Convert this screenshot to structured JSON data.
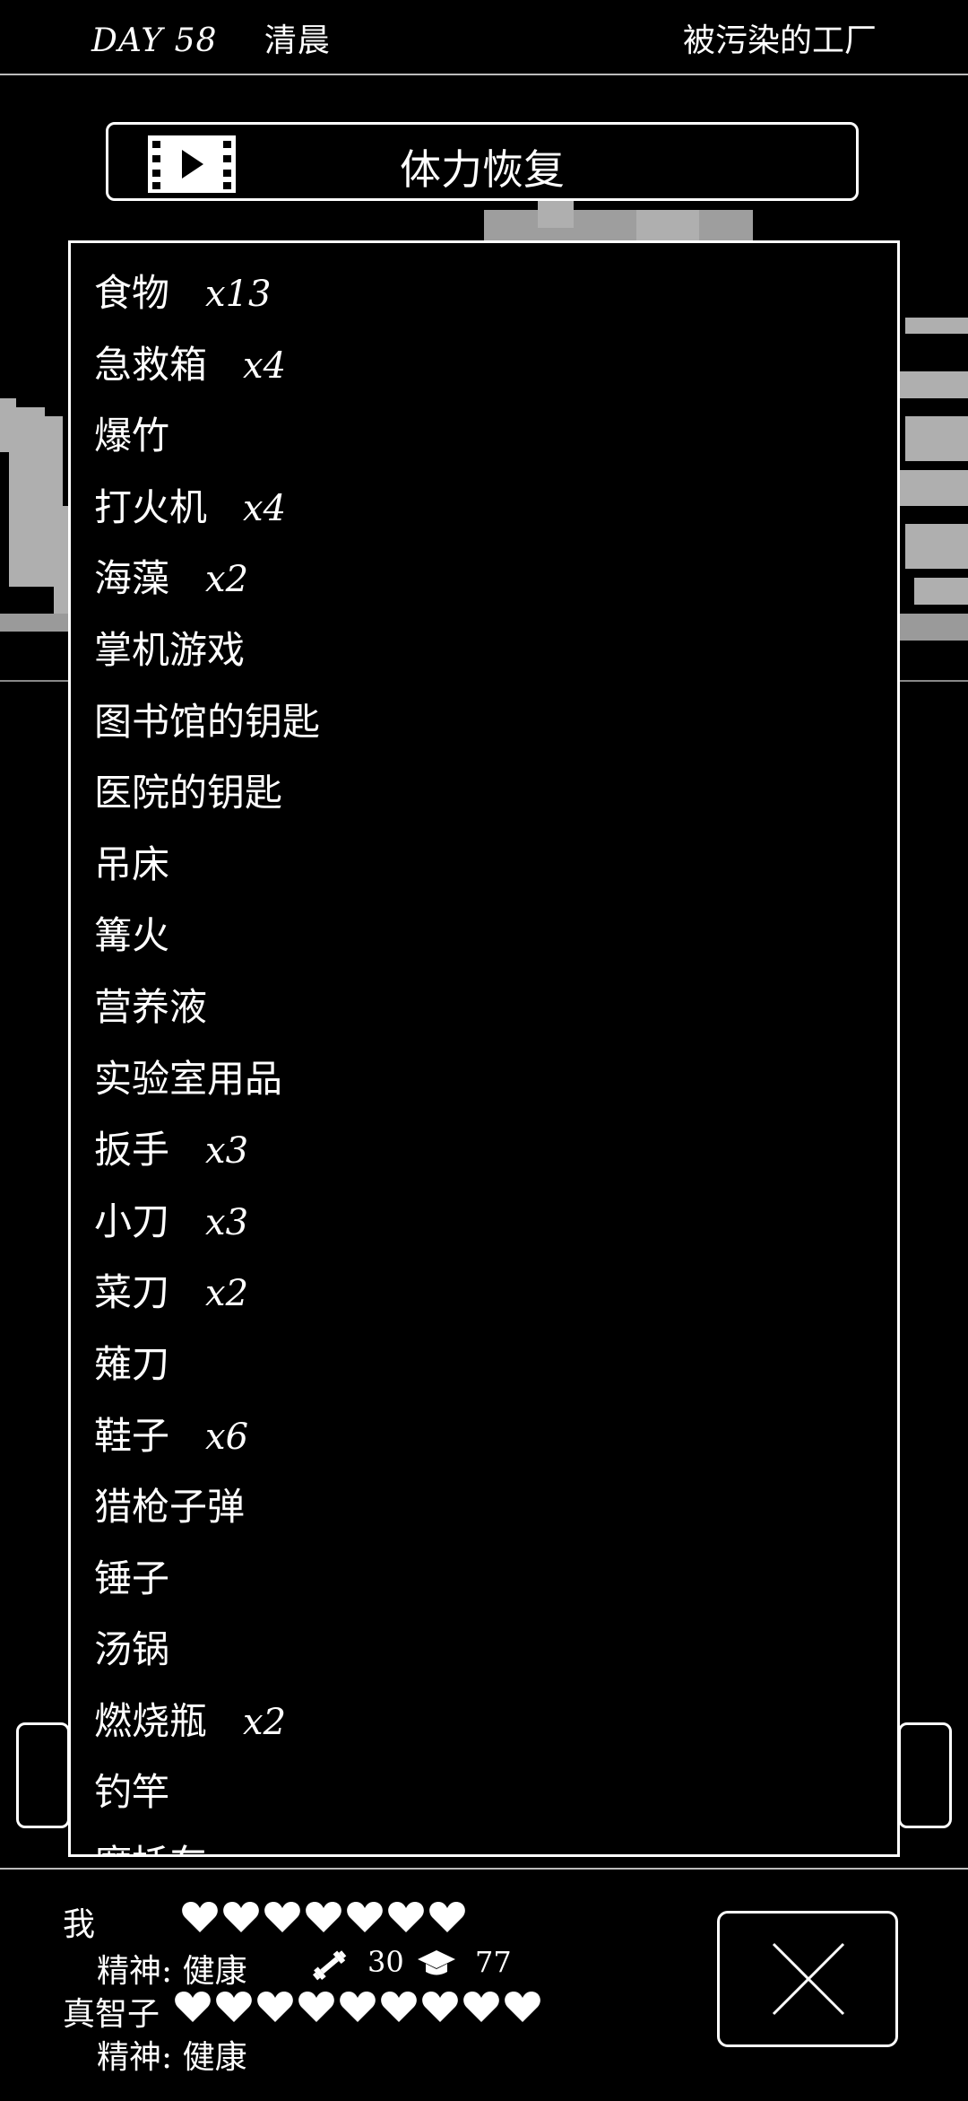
{
  "header": {
    "day": "DAY 58",
    "time_of_day": "清晨",
    "location": "被污染的工厂"
  },
  "action_button": {
    "icon": "film-icon",
    "label": "体力恢复"
  },
  "inventory": {
    "items": [
      {
        "name": "食物",
        "qty": "x13"
      },
      {
        "name": "急救箱",
        "qty": "x4"
      },
      {
        "name": "爆竹",
        "qty": ""
      },
      {
        "name": "打火机",
        "qty": "x4"
      },
      {
        "name": "海藻",
        "qty": "x2"
      },
      {
        "name": "掌机游戏",
        "qty": ""
      },
      {
        "name": "图书馆的钥匙",
        "qty": ""
      },
      {
        "name": "医院的钥匙",
        "qty": ""
      },
      {
        "name": "吊床",
        "qty": ""
      },
      {
        "name": "篝火",
        "qty": ""
      },
      {
        "name": "营养液",
        "qty": ""
      },
      {
        "name": "实验室用品",
        "qty": ""
      },
      {
        "name": "扳手",
        "qty": "x3"
      },
      {
        "name": "小刀",
        "qty": "x3"
      },
      {
        "name": "菜刀",
        "qty": "x2"
      },
      {
        "name": "薙刀",
        "qty": ""
      },
      {
        "name": "鞋子",
        "qty": "x6"
      },
      {
        "name": "猎枪子弹",
        "qty": ""
      },
      {
        "name": "锤子",
        "qty": ""
      },
      {
        "name": "汤锅",
        "qty": ""
      },
      {
        "name": "燃烧瓶",
        "qty": "x2"
      },
      {
        "name": "钓竿",
        "qty": ""
      },
      {
        "name": "摩托车",
        "qty": ""
      }
    ]
  },
  "status": {
    "player": {
      "name": "我",
      "hearts": 7,
      "mind_label": "精神:",
      "mind_value": "健康",
      "strength": "30",
      "intelligence": "77"
    },
    "companion": {
      "name": "真智子",
      "hearts": 9,
      "mind_label": "精神:",
      "mind_value": "健康"
    }
  },
  "close_button": {
    "icon": "close-icon"
  }
}
